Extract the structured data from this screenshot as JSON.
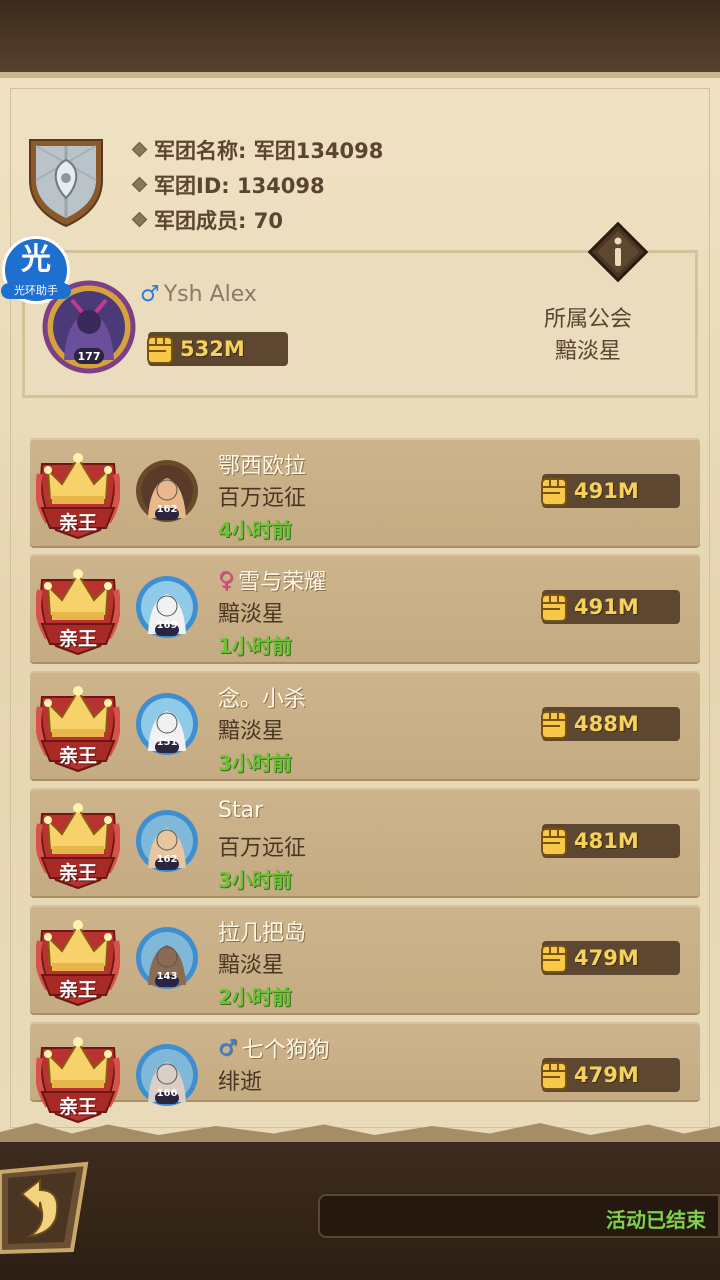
{
  "legion": {
    "name_line": "军团名称: 军团134098",
    "id_line": "军团ID: 134098",
    "members_line": "军团成员: 70"
  },
  "watermark": {
    "main": "光",
    "sub": "光环助手"
  },
  "me": {
    "gender": "♂",
    "name": "Ysh Alex",
    "level": "177",
    "power": "532M",
    "guild_label": "所属公会",
    "guild_name": "黯淡星"
  },
  "members": [
    {
      "rank": "亲王",
      "level": "162",
      "gender": "",
      "name": "鄂西欧拉",
      "guild": "百万远征",
      "time": "4小时前",
      "power": "491M"
    },
    {
      "rank": "亲王",
      "level": "169",
      "gender": "♀",
      "name": "雪与荣耀",
      "guild": "黯淡星",
      "time": "1小时前",
      "power": "491M"
    },
    {
      "rank": "亲王",
      "level": "151",
      "gender": "",
      "name": "念。小杀",
      "guild": "黯淡星",
      "time": "3小时前",
      "power": "488M"
    },
    {
      "rank": "亲王",
      "level": "162",
      "gender": "",
      "name": "Star",
      "guild": "百万远征",
      "time": "3小时前",
      "power": "481M"
    },
    {
      "rank": "亲王",
      "level": "143",
      "gender": "",
      "name": "拉几把岛",
      "guild": "黯淡星",
      "time": "2小时前",
      "power": "479M"
    },
    {
      "rank": "亲王",
      "level": "166",
      "gender": "♂",
      "name": "七个狗狗",
      "guild": "绯逝",
      "time": "",
      "power": "479M"
    }
  ],
  "footer": {
    "status": "活动已结束"
  },
  "colors": {
    "power_gold": "#f6d15c",
    "time_green": "#6fc13a",
    "rank_red": "#b8332f",
    "status_green": "#7fd04a"
  }
}
